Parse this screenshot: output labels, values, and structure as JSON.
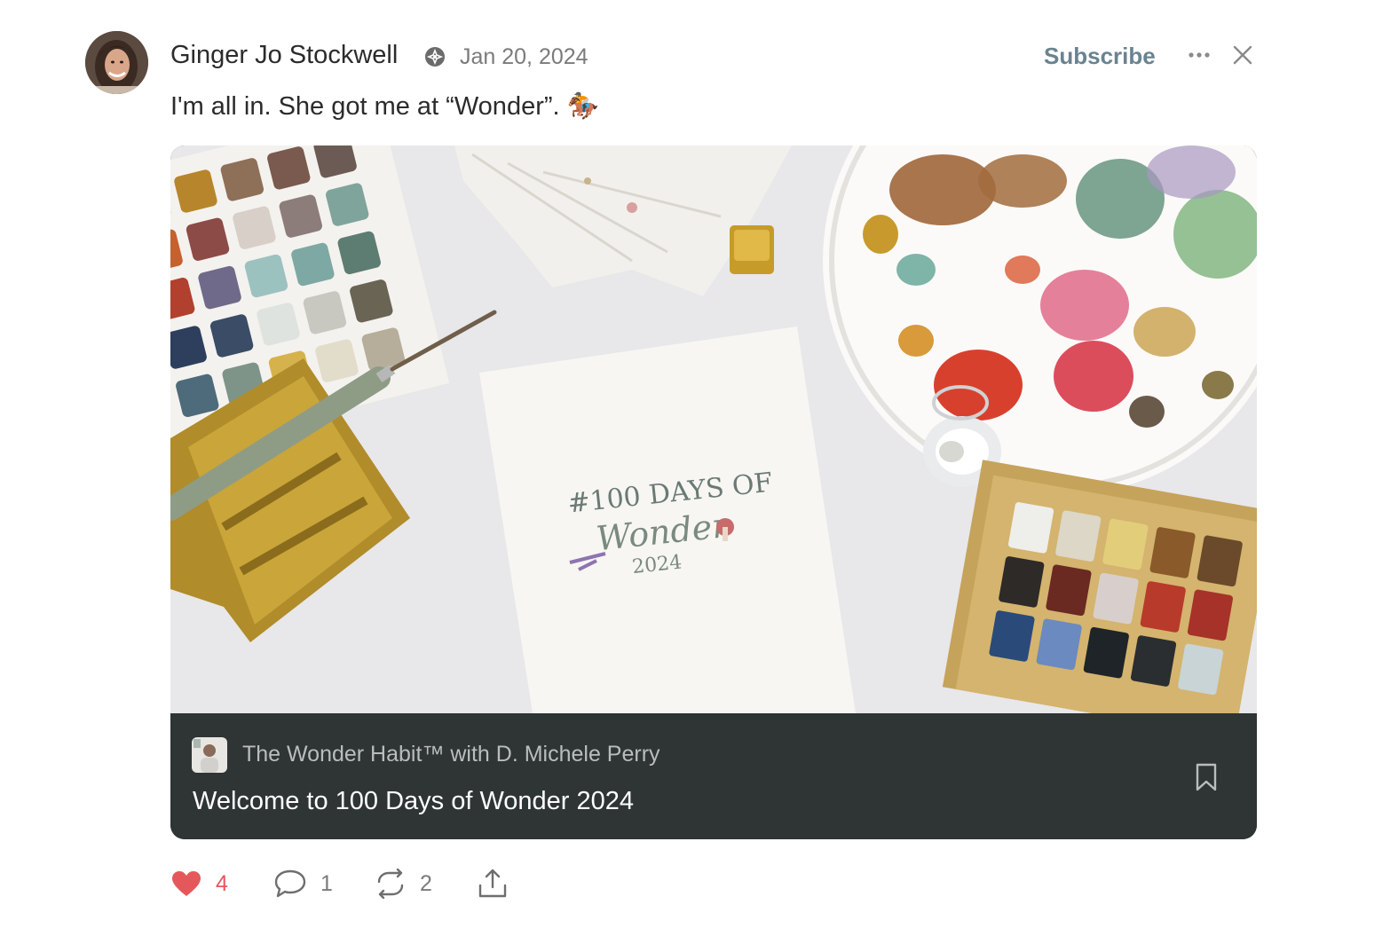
{
  "post": {
    "author": "Ginger Jo Stockwell",
    "date": "Jan 20, 2024",
    "subscribe_label": "Subscribe",
    "text": "I'm all in. She got me at “Wonder”. 🏇"
  },
  "card": {
    "image_art_text": "#100 DAYS OF Wonder 2024",
    "publication": "The Wonder Habit™ with D. Michele Perry",
    "title": "Welcome to 100 Days of Wonder 2024"
  },
  "actions": {
    "likes": "4",
    "comments": "1",
    "restacks": "2"
  },
  "colors": {
    "accent": "#6a8390",
    "like": "#e4585c",
    "card_footer": "#2f3434"
  },
  "icons": [
    "verified-badge-icon",
    "more-icon",
    "close-icon",
    "bookmark-icon",
    "heart-icon",
    "comment-icon",
    "restack-icon",
    "share-icon"
  ]
}
